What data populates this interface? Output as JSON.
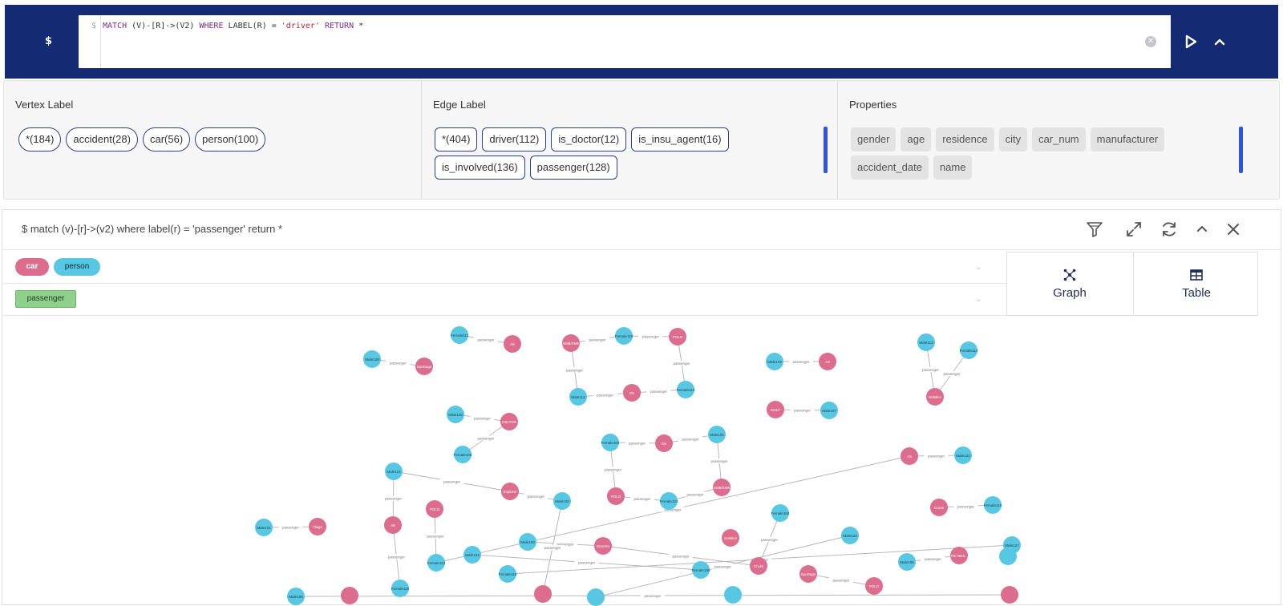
{
  "query_bar": {
    "prompt": "$",
    "gutter": "$",
    "query_parts": {
      "match_kw": "MATCH",
      "pattern": " (V)-[R]->(V2) ",
      "where_kw": "WHERE",
      "label_fn": " LABEL(R) = ",
      "value": "'driver'",
      "return_kw": " RETURN",
      "star": " *"
    }
  },
  "labels_panel": {
    "vertex": {
      "title": "Vertex Label",
      "chips": [
        "*(184)",
        "accident(28)",
        "car(56)",
        "person(100)"
      ]
    },
    "edge": {
      "title": "Edge Label",
      "chips": [
        "*(404)",
        "driver(112)",
        "is_doctor(12)",
        "is_insu_agent(16)",
        "is_involved(136)",
        "passenger(128)"
      ]
    },
    "properties": {
      "title": "Properties",
      "chips": [
        "gender",
        "age",
        "residence",
        "city",
        "car_num",
        "manufacturer",
        "accident_date",
        "name"
      ]
    }
  },
  "results": {
    "query": "$ match (v)-[r]->(v2) where label(r) = 'passenger' return *",
    "vertex_legend": [
      {
        "label": "car",
        "color": "#dc6d8f"
      },
      {
        "label": "person",
        "color": "#57c7e3"
      }
    ],
    "edge_legend": [
      {
        "label": "passenger",
        "color": "#8fd08d"
      }
    ],
    "tabs": [
      {
        "label": "Graph",
        "icon": "graph-icon"
      },
      {
        "label": "Table",
        "icon": "table-icon"
      }
    ]
  },
  "graph": {
    "colors": {
      "car": "#dc6d8f",
      "person": "#57c7e3",
      "edge": "#b8b8b8"
    },
    "edge_label": "passenger",
    "nodes": [
      {
        "id": "p1",
        "type": "person",
        "label": "Female111"
      },
      {
        "id": "c1",
        "type": "car",
        "label": "A8"
      },
      {
        "id": "p2",
        "type": "person",
        "label": "Male108"
      },
      {
        "id": "c2",
        "type": "car",
        "label": "Sportage"
      },
      {
        "id": "c3",
        "type": "car",
        "label": "SM6/SM5"
      },
      {
        "id": "p3",
        "type": "person",
        "label": "Female115"
      },
      {
        "id": "c4",
        "type": "car",
        "label": "POLO"
      },
      {
        "id": "p4",
        "type": "person",
        "label": "Male112"
      },
      {
        "id": "c5",
        "type": "car",
        "label": "K5"
      },
      {
        "id": "p5",
        "type": "person",
        "label": "Female113"
      },
      {
        "id": "p6",
        "type": "person",
        "label": "Male104"
      },
      {
        "id": "c6",
        "type": "car",
        "label": "A4"
      },
      {
        "id": "p7",
        "type": "person",
        "label": "Male113"
      },
      {
        "id": "p8",
        "type": "person",
        "label": "Female114"
      },
      {
        "id": "c7",
        "type": "car",
        "label": "Solstice"
      },
      {
        "id": "c8",
        "type": "car",
        "label": "GOLF"
      },
      {
        "id": "p9",
        "type": "person",
        "label": "Male107"
      },
      {
        "id": "p10",
        "type": "person",
        "label": "Male125"
      },
      {
        "id": "c9",
        "type": "car",
        "label": "CELTOS"
      },
      {
        "id": "p11",
        "type": "person",
        "label": "Female106"
      },
      {
        "id": "p12",
        "type": "person",
        "label": "Female102"
      },
      {
        "id": "c10",
        "type": "car",
        "label": "K5"
      },
      {
        "id": "p13",
        "type": "person",
        "label": "Male102"
      },
      {
        "id": "c11",
        "type": "car",
        "label": "A3"
      },
      {
        "id": "p14",
        "type": "person",
        "label": "Male123"
      },
      {
        "id": "p15",
        "type": "person",
        "label": "Female118"
      },
      {
        "id": "c12",
        "type": "car",
        "label": "POLO"
      },
      {
        "id": "p16",
        "type": "person",
        "label": "Female123"
      },
      {
        "id": "c13",
        "type": "car",
        "label": "SM6/SM5"
      },
      {
        "id": "c14",
        "type": "car",
        "label": "Explorer"
      },
      {
        "id": "p17",
        "type": "person",
        "label": "Male114"
      },
      {
        "id": "c15",
        "type": "car",
        "label": "POLO"
      },
      {
        "id": "c16",
        "type": "car",
        "label": "Cruze"
      },
      {
        "id": "p18",
        "type": "person",
        "label": "Female112"
      },
      {
        "id": "p19",
        "type": "person",
        "label": "Male120"
      },
      {
        "id": "c17",
        "type": "car",
        "label": "Tiago"
      },
      {
        "id": "c18",
        "type": "car",
        "label": "A6"
      },
      {
        "id": "p20",
        "type": "person",
        "label": "Male101"
      },
      {
        "id": "c19",
        "type": "car",
        "label": "Sorento"
      },
      {
        "id": "p21",
        "type": "person",
        "label": "Male103"
      },
      {
        "id": "c20",
        "type": "car",
        "label": "Solstice"
      },
      {
        "id": "p22",
        "type": "person",
        "label": "Female104"
      },
      {
        "id": "p23",
        "type": "person",
        "label": "Male124"
      },
      {
        "id": "p24",
        "type": "person",
        "label": "Female116"
      },
      {
        "id": "p25",
        "type": "person",
        "label": "Male122"
      },
      {
        "id": "c21",
        "type": "car",
        "label": "Cruze"
      },
      {
        "id": "p26",
        "type": "person",
        "label": "Female105"
      },
      {
        "id": "c22",
        "type": "car",
        "label": "Sportage"
      },
      {
        "id": "c23",
        "type": "car",
        "label": "POLO"
      },
      {
        "id": "p27",
        "type": "person",
        "label": "Male105"
      },
      {
        "id": "c24",
        "type": "car",
        "label": "The NEX..."
      },
      {
        "id": "p28",
        "type": "person",
        "label": "Male127"
      },
      {
        "id": "p29",
        "type": "person",
        "label": "Female110"
      },
      {
        "id": "p30",
        "type": "person",
        "label": "Male106"
      },
      {
        "id": "c25",
        "type": "car",
        "label": ""
      },
      {
        "id": "c26",
        "type": "car",
        "label": ""
      },
      {
        "id": "p31",
        "type": "person",
        "label": ""
      },
      {
        "id": "p32",
        "type": "person",
        "label": ""
      },
      {
        "id": "p33",
        "type": "person",
        "label": ""
      },
      {
        "id": "c27",
        "type": "car",
        "label": ""
      }
    ],
    "edges": [
      [
        "p1",
        "c1"
      ],
      [
        "p2",
        "c2"
      ],
      [
        "c3",
        "p3"
      ],
      [
        "p3",
        "c4"
      ],
      [
        "c3",
        "p4"
      ],
      [
        "p4",
        "c5"
      ],
      [
        "c5",
        "p5"
      ],
      [
        "c4",
        "p5"
      ],
      [
        "p6",
        "c6"
      ],
      [
        "p7",
        "c7"
      ],
      [
        "p8",
        "c7"
      ],
      [
        "c8",
        "p9"
      ],
      [
        "p10",
        "c9"
      ],
      [
        "p11",
        "c9"
      ],
      [
        "p12",
        "c10"
      ],
      [
        "c10",
        "p13"
      ],
      [
        "p12",
        "c12"
      ],
      [
        "p13",
        "c13"
      ],
      [
        "c12",
        "p16"
      ],
      [
        "p16",
        "c13"
      ],
      [
        "c11",
        "p14"
      ],
      [
        "c16",
        "p15"
      ],
      [
        "p17",
        "c14"
      ],
      [
        "c14",
        "p19"
      ],
      [
        "p17",
        "c18"
      ],
      [
        "p18",
        "c11"
      ],
      [
        "c17",
        "p20"
      ],
      [
        "p18",
        "c15"
      ],
      [
        "p21",
        "c19"
      ],
      [
        "c19",
        "c21"
      ],
      [
        "p22",
        "c21"
      ],
      [
        "c22",
        "c23"
      ],
      [
        "p27",
        "c24"
      ],
      [
        "p23",
        "p26"
      ],
      [
        "p19",
        "c25"
      ],
      [
        "p24",
        "p28"
      ],
      [
        "p25",
        "p31"
      ],
      [
        "c18",
        "p29"
      ],
      [
        "p30",
        "c27"
      ]
    ]
  }
}
